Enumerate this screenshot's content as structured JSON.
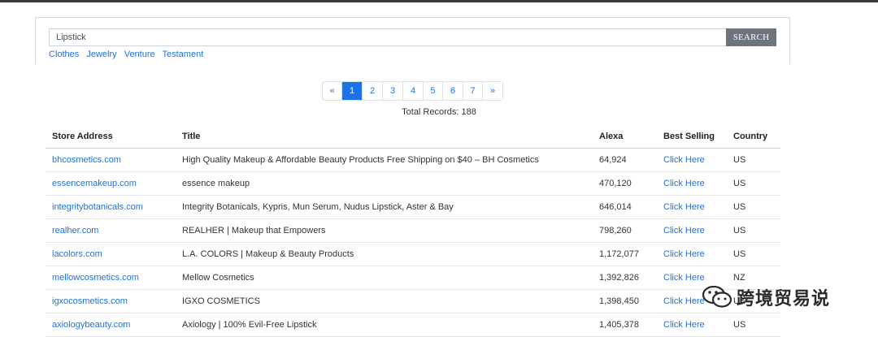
{
  "search": {
    "value": "Lipstick",
    "button_label": "SEARCH"
  },
  "quick_links": [
    "Clothes",
    "Jewelry",
    "Venture",
    "Testament"
  ],
  "pagination": {
    "prev": "«",
    "pages": [
      "1",
      "2",
      "3",
      "4",
      "5",
      "6",
      "7"
    ],
    "next": "»",
    "active": "1"
  },
  "total_records": "Total Records: 188",
  "table": {
    "headers": [
      "Store Address",
      "Title",
      "Alexa",
      "Best Selling",
      "Country"
    ],
    "rows": [
      {
        "store": "bhcosmetics.com",
        "title": "High Quality Makeup & Affordable Beauty Products Free Shipping on $40 – BH Cosmetics",
        "alexa": "64,924",
        "best": "Click Here",
        "country": "US"
      },
      {
        "store": "essencemakeup.com",
        "title": "essence makeup",
        "alexa": "470,120",
        "best": "Click Here",
        "country": "US"
      },
      {
        "store": "integritybotanicals.com",
        "title": "Integrity Botanicals, Kypris, Mun Serum, Nudus Lipstick, Aster & Bay",
        "alexa": "646,014",
        "best": "Click Here",
        "country": "US"
      },
      {
        "store": "realher.com",
        "title": "REALHER | Makeup that Empowers",
        "alexa": "798,260",
        "best": "Click Here",
        "country": "US"
      },
      {
        "store": "lacolors.com",
        "title": "L.A. COLORS | Makeup & Beauty Products",
        "alexa": "1,172,077",
        "best": "Click Here",
        "country": "US"
      },
      {
        "store": "mellowcosmetics.com",
        "title": "Mellow Cosmetics",
        "alexa": "1,392,826",
        "best": "Click Here",
        "country": "NZ"
      },
      {
        "store": "igxocosmetics.com",
        "title": "IGXO COSMETICS",
        "alexa": "1,398,450",
        "best": "Click Here",
        "country": "US"
      },
      {
        "store": "axiologybeauty.com",
        "title": "Axiology | 100% Evil-Free Lipstick",
        "alexa": "1,405,378",
        "best": "Click Here",
        "country": "US"
      }
    ]
  },
  "watermark": {
    "text": "跨境贸易说",
    "icon": "wechat-icon"
  },
  "colors": {
    "link": "#1a73e8",
    "button": "#6c757d",
    "active_page": "#1a73e8"
  }
}
